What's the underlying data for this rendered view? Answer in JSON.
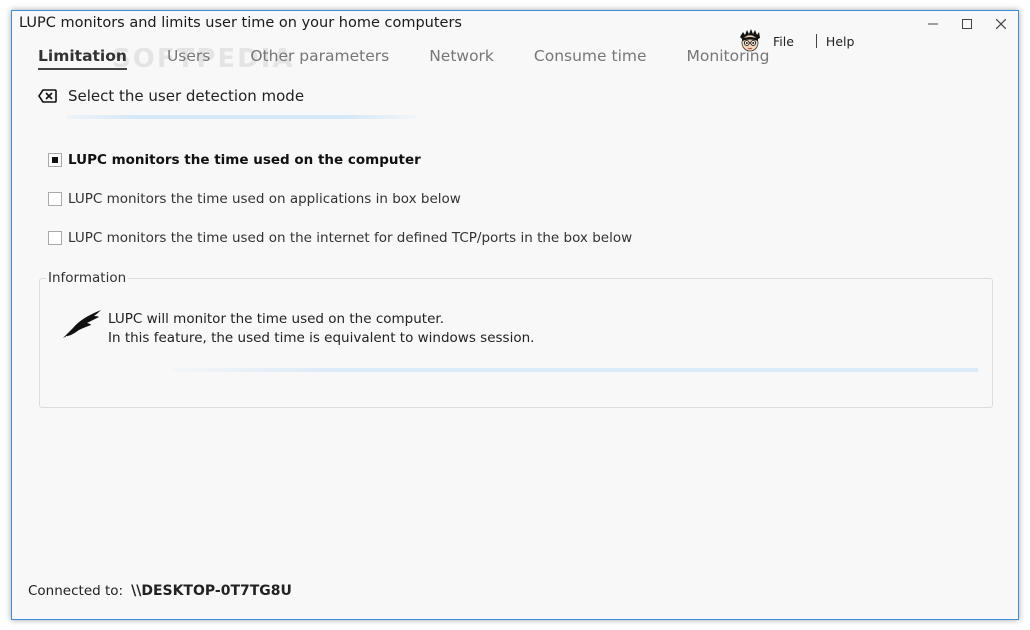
{
  "window": {
    "title": "LUPC monitors and limits user time on your home computers",
    "controls": {
      "minimize": "–",
      "maximize": "□",
      "close": "✕"
    }
  },
  "watermark": "SOFTPEDIA",
  "tabs": [
    {
      "label": "Limitation",
      "active": true
    },
    {
      "label": "Users",
      "active": false
    },
    {
      "label": "Other parameters",
      "active": false
    },
    {
      "label": "Network",
      "active": false
    },
    {
      "label": "Consume time",
      "active": false
    },
    {
      "label": "Monitoring",
      "active": false
    }
  ],
  "menu": {
    "avatar_icon": "cartoon-avatar-icon",
    "file": "File",
    "help": "Help"
  },
  "section": {
    "icon": "close-box-icon",
    "title": "Select the user detection mode"
  },
  "options": [
    {
      "label": "LUPC monitors the time used on the computer",
      "checked": true
    },
    {
      "label": "LUPC monitors the time used on applications in box below",
      "checked": false
    },
    {
      "label": "LUPC monitors the time used on the internet for defined TCP/ports in the box below",
      "checked": false
    }
  ],
  "info": {
    "legend": "Information",
    "icon": "quill-icon",
    "line1": "LUPC will monitor the time used on the computer.",
    "line2": "In this feature, the used time is equivalent to windows session."
  },
  "status": {
    "label": "Connected to:",
    "value": "\\\\DESKTOP-0T7TG8U"
  },
  "colors": {
    "window_border": "#3e8ed8",
    "accent_underline": "#d4e8f8"
  }
}
